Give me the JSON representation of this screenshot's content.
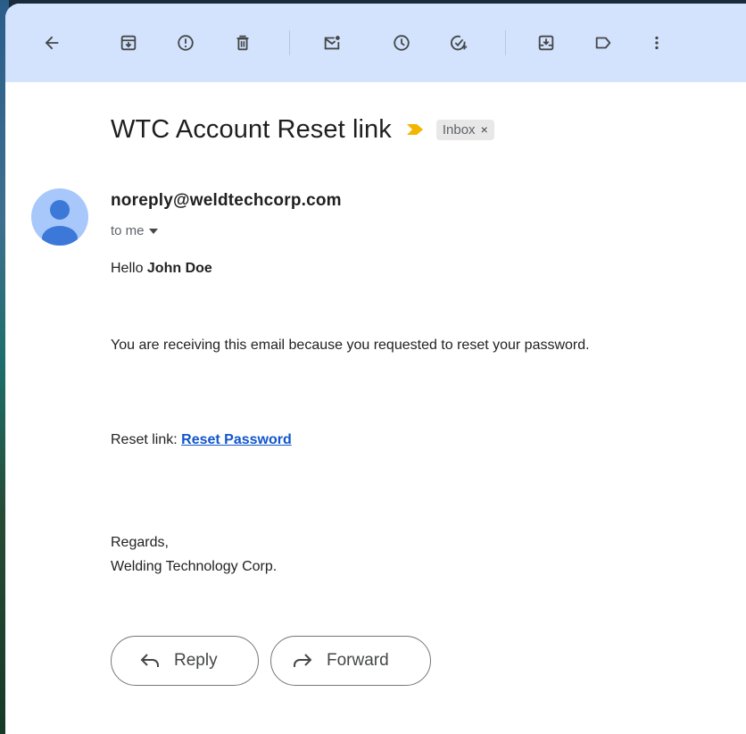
{
  "toolbar": {
    "icons": [
      "back-arrow-icon",
      "archive-icon",
      "report-spam-icon",
      "delete-icon",
      "mark-unread-icon",
      "snooze-icon",
      "add-task-icon",
      "move-to-icon",
      "label-icon",
      "more-icon"
    ]
  },
  "email": {
    "subject": "WTC Account Reset link",
    "label": "Inbox",
    "label_remove": "×",
    "sender": "noreply@weldtechcorp.com",
    "recipient": "to me",
    "greeting_prefix": "Hello ",
    "greeting_name": "John Doe",
    "body_line": "You are receiving this email because you requested to reset your password.",
    "reset_prefix": "Reset link: ",
    "reset_link_text": "Reset Password",
    "closing": "Regards,",
    "signature": "Welding Technology Corp."
  },
  "actions": {
    "reply": "Reply",
    "forward": "Forward"
  },
  "colors": {
    "toolbar_bg": "#d3e3fd",
    "importance": "#f2b600",
    "link": "#1155cc",
    "avatar": "#a8c7fa",
    "avatar_figure": "#3c78d8"
  }
}
